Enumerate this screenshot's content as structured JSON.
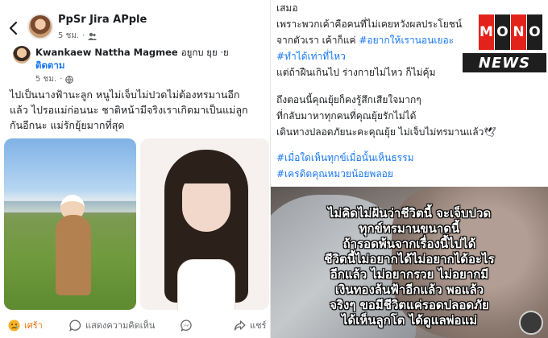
{
  "left_post": {
    "page_name": "PpSr Jira APple",
    "page_time": "5 ชม.",
    "shared_author": "Kwankaew Nattha Magmee",
    "shared_location": "อยูกบ ยุย ·ย",
    "follow_label": "ติดตาม",
    "shared_time": "5 ชม.",
    "text_lines": [
      "ไปเป็นนางฟ้านะลูก หนูไม่เจ็บไม่ปวดไม่ต้องทรมานอีก",
      "แล้ว ไปรอแม่ก่อนนะ ชาติหน้ามีจริงเราเกิดมาเป็นแม่ลูก",
      "กันอีกนะ แม่รักยุ้ยมากที่สุด"
    ],
    "actions": {
      "react": "เศร้า",
      "comment": "แสดงความคิดเห็น",
      "share": "ส่ง",
      "more": "แชร์"
    }
  },
  "right_post": {
    "lines": [
      {
        "text": "เสมอ",
        "hashtag": false
      },
      {
        "text": "เพราะพวกเค้าคือคนที่ไม่เคยหวังผลประโยชน์",
        "hashtag": false
      },
      {
        "text": "จากตัวเรา เค้าก็แค่ ",
        "hashtag": false,
        "tag": "#อยากให้เรานอนเยอะ"
      },
      {
        "text": "#ทำได้เท่าที่ไหว",
        "hashtag": true
      },
      {
        "text": "แต่ถ้าฝืนเกินไป ร่างกายไม่ไหว ก็ไม่คุ้ม",
        "hashtag": false
      },
      {
        "text": "ถึงตอนนี้คุณยุ้ยก็คงรู้สึกเสียใจมากๆ",
        "hashtag": false
      },
      {
        "text": "ที่กลับมาหาทุกคนที่คุณยุ้ยรักไม่ได้",
        "hashtag": false
      },
      {
        "text": "เดินทางปลอดภัยนะคะคุณยุ้ย ไม่เจ็บไม่ทรมานแล้ว🕊",
        "hashtag": false
      },
      {
        "text": "#เมื่อใดเห็นทุกข์เมื่อนั้นเห็นธรรม",
        "hashtag": true
      },
      {
        "text": "#เครดิตคุณหมวยน้อยพลอย",
        "hashtag": true
      }
    ],
    "logo": {
      "letters": [
        "M",
        "O",
        "N",
        "O"
      ],
      "news": "NEWS"
    },
    "overlay_lines": [
      "ไม่คิดไม่ฝันว่าชีวิตนี้ จะเจ็บปวด",
      "ทุกข์ทรมานขนาดนี้",
      "ถ้ารอดพ้นจากเรื่องนี้ไปได้",
      "ชีวิตนี้ไม่อยากได้ไม่อยากได้อะไร",
      "อีกแล้ว ไม่อยากรวย ไม่อยากมี",
      "เงินทองล้นฟ้าอีกแล้ว พอแล้ว",
      "จริงๆ ขอมีชีวิตแค่รอดปลอดภัย",
      "ได้เห็นลูกโต ได้ดูแลพ่อแม่"
    ]
  },
  "colors": {
    "link_blue": "#1877f2",
    "react_orange": "#e9710f",
    "logo_red": "#e3231b",
    "logo_dark": "#1e1e1e"
  }
}
